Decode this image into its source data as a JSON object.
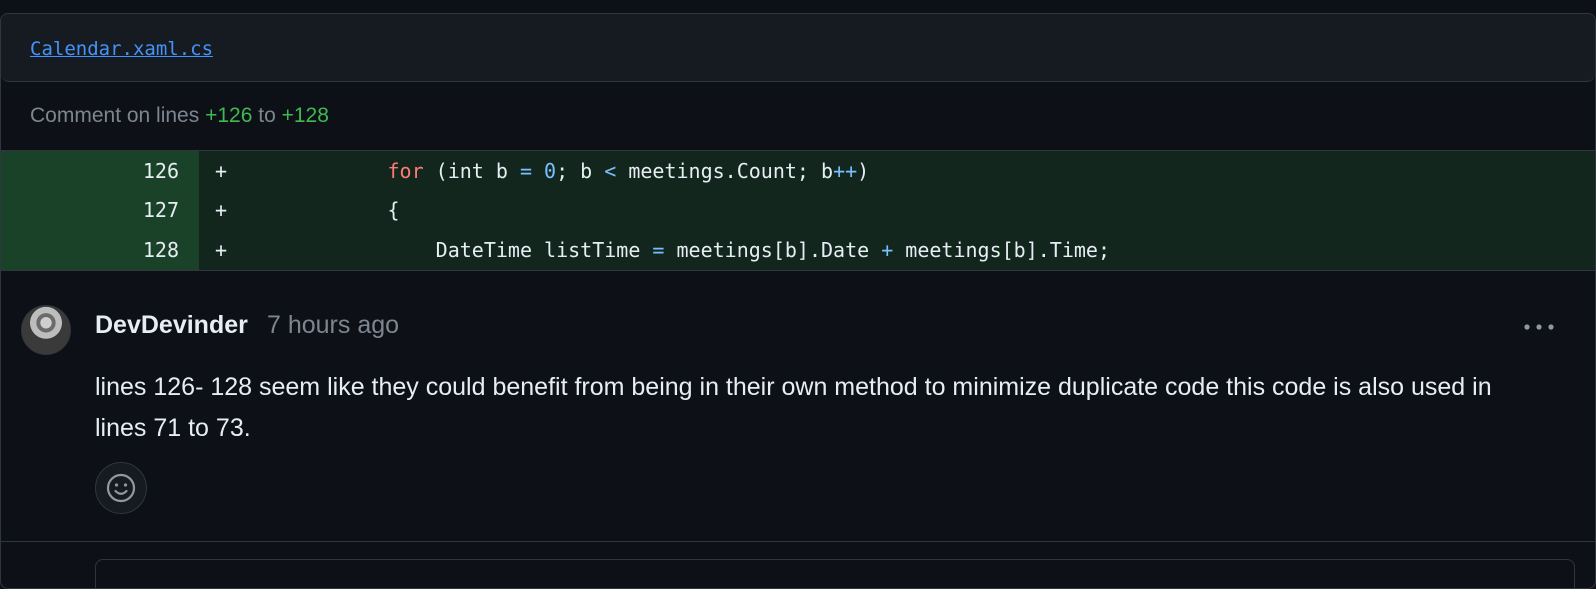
{
  "file": {
    "name": "Calendar.xaml.cs"
  },
  "comment_on": {
    "prefix": "Comment on lines",
    "start": "+126",
    "joiner": "to",
    "end": "+128"
  },
  "diff": {
    "rows": [
      {
        "line": "126",
        "marker": "+"
      },
      {
        "line": "127",
        "marker": "+"
      },
      {
        "line": "128",
        "marker": "+"
      }
    ],
    "code": {
      "l126": {
        "indent": "            ",
        "kw": "for",
        "a": " (int b ",
        "eq": "=",
        "b": " ",
        "zero": "0",
        "c": "; b ",
        "lt": "<",
        "d": " meetings.Count; b",
        "pp": "++",
        "e": ")"
      },
      "l127": {
        "indent": "            ",
        "text": "{"
      },
      "l128": {
        "indent": "                ",
        "a": "DateTime listTime ",
        "eq": "=",
        "b": " meetings[b].Date ",
        "plus": "+",
        "c": " meetings[b].Time;"
      }
    }
  },
  "comment": {
    "author": "DevDevinder",
    "time": "7 hours ago",
    "body": "lines 126- 128 seem like they could benefit from being in their own method to minimize duplicate code this code is also used in lines 71 to 73.",
    "more_icon": "kebab-horizontal-icon",
    "reaction_icon": "smiley-icon"
  }
}
